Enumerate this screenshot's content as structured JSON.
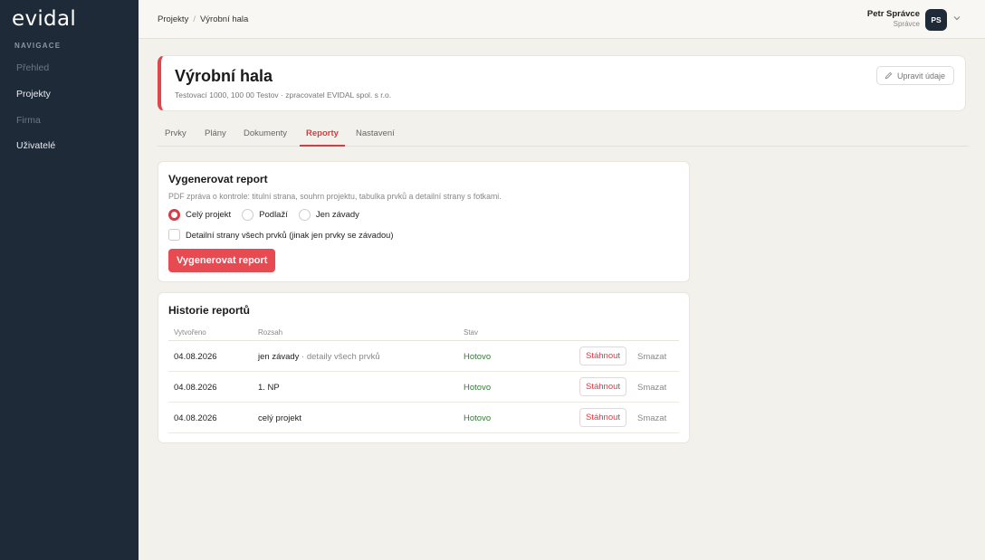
{
  "sidebar": {
    "logo": "evidal",
    "heading": "NAVIGACE",
    "items": [
      {
        "label": "Přehled"
      },
      {
        "label": "Projekty"
      },
      {
        "label": "Firma"
      },
      {
        "label": "Uživatelé"
      }
    ]
  },
  "topbar": {
    "breadcrumb": [
      "Projekty",
      "Výrobní hala"
    ],
    "user_name": "Petr Správce",
    "user_role": "Správce",
    "avatar_initials": "PS"
  },
  "project": {
    "title": "Výrobní hala",
    "subtitle": "Testovací 1000, 100 00 Testov · zpracovatel EVIDAL spol. s r.o.",
    "edit_label": "Upravit údaje"
  },
  "tabs": [
    {
      "label": "Prvky"
    },
    {
      "label": "Plány"
    },
    {
      "label": "Dokumenty"
    },
    {
      "label": "Reporty"
    },
    {
      "label": "Nastavení"
    }
  ],
  "generate": {
    "title": "Vygenerovat report",
    "description": "PDF zpráva o kontrole: titulní strana, souhrn projektu, tabulka prvků a detailní strany s fotkami.",
    "scope_options": [
      {
        "label": "Celý projekt",
        "selected": true
      },
      {
        "label": "Podlaží",
        "selected": false
      },
      {
        "label": "Jen závady",
        "selected": false
      }
    ],
    "detail_checkbox_label": "Detailní strany všech prvků (jinak jen prvky se závadou)",
    "button_label": "Vygenerovat report"
  },
  "history": {
    "title": "Historie reportů",
    "columns": [
      "Vytvořeno",
      "Rozsah",
      "Stav"
    ],
    "rows": [
      {
        "date": "04.08.2026",
        "scope": "jen závady",
        "scope_extra": " · detaily všech prvků",
        "status": "Hotovo",
        "download": "Stáhnout",
        "delete": "Smazat"
      },
      {
        "date": "04.08.2026",
        "scope": "1. NP",
        "scope_extra": "",
        "status": "Hotovo",
        "download": "Stáhnout",
        "delete": "Smazat"
      },
      {
        "date": "04.08.2026",
        "scope": "celý projekt",
        "scope_extra": "",
        "status": "Hotovo",
        "download": "Stáhnout",
        "delete": "Smazat"
      }
    ]
  },
  "colors": {
    "accent": "#e84a52",
    "sidebar": "#1e2a38",
    "status_ok": "#2e7d32"
  }
}
